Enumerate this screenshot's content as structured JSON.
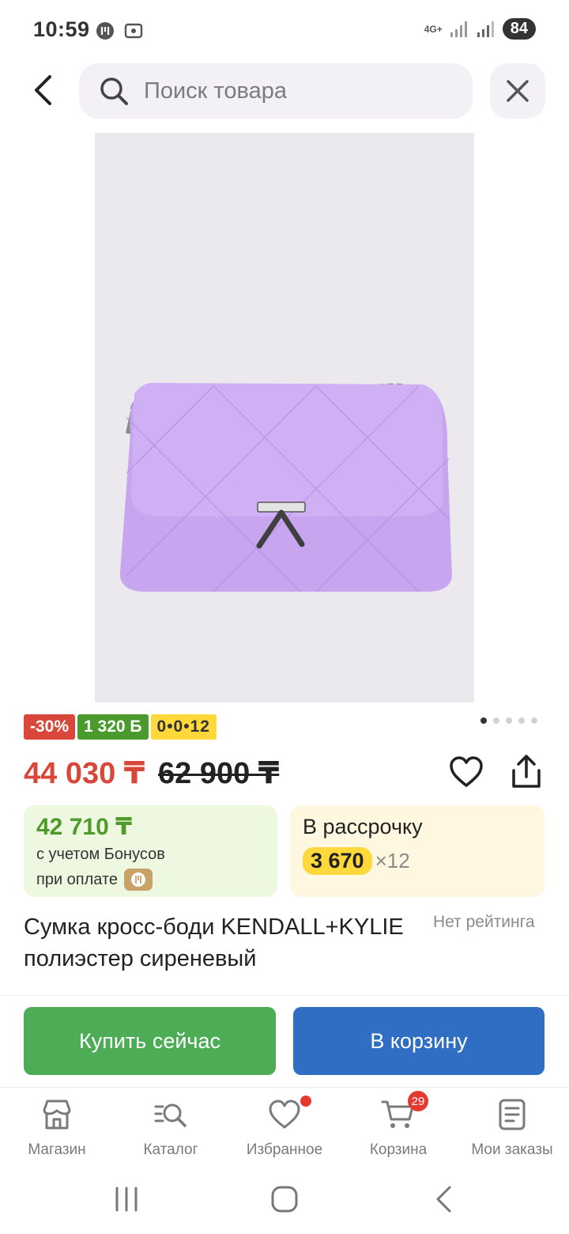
{
  "status_bar": {
    "time": "10:59",
    "network": "4G+",
    "battery": "84"
  },
  "search": {
    "placeholder": "Поиск товара"
  },
  "gallery": {
    "dots_count": 5,
    "active_index": 0
  },
  "badges": {
    "discount": "-30%",
    "bonus": "1 320 Б",
    "installment": "0•0•12"
  },
  "price": {
    "current": "44 030 ₸",
    "old": "62 900 ₸"
  },
  "bonus_card": {
    "price": "42 710 ₸",
    "line1": "с учетом Бонусов",
    "line2": "при оплате"
  },
  "installment_card": {
    "title": "В рассрочку",
    "amount": "3 670",
    "multiplier": "×12"
  },
  "product": {
    "title": "Сумка кросс-боди KENDALL+KYLIE полиэстер сиреневый",
    "rating": "Нет рейтинга",
    "brand_plate": "KENDALL+KYLIE"
  },
  "actions": {
    "buy_now": "Купить сейчас",
    "add_to_cart": "В корзину"
  },
  "tabs": [
    {
      "label": "Магазин",
      "icon": "store-icon"
    },
    {
      "label": "Каталог",
      "icon": "catalog-search-icon"
    },
    {
      "label": "Избранное",
      "icon": "heart-icon"
    },
    {
      "label": "Корзина",
      "icon": "cart-icon",
      "badge": "29"
    },
    {
      "label": "Мои заказы",
      "icon": "orders-icon"
    }
  ],
  "colors": {
    "discount_red": "#d9473a",
    "bonus_green": "#4b9a2d",
    "installment_yellow": "#ffd83b",
    "buy_green": "#4dac56",
    "cart_blue": "#2f6ec3",
    "bag_lilac": "#c7a6ef"
  }
}
